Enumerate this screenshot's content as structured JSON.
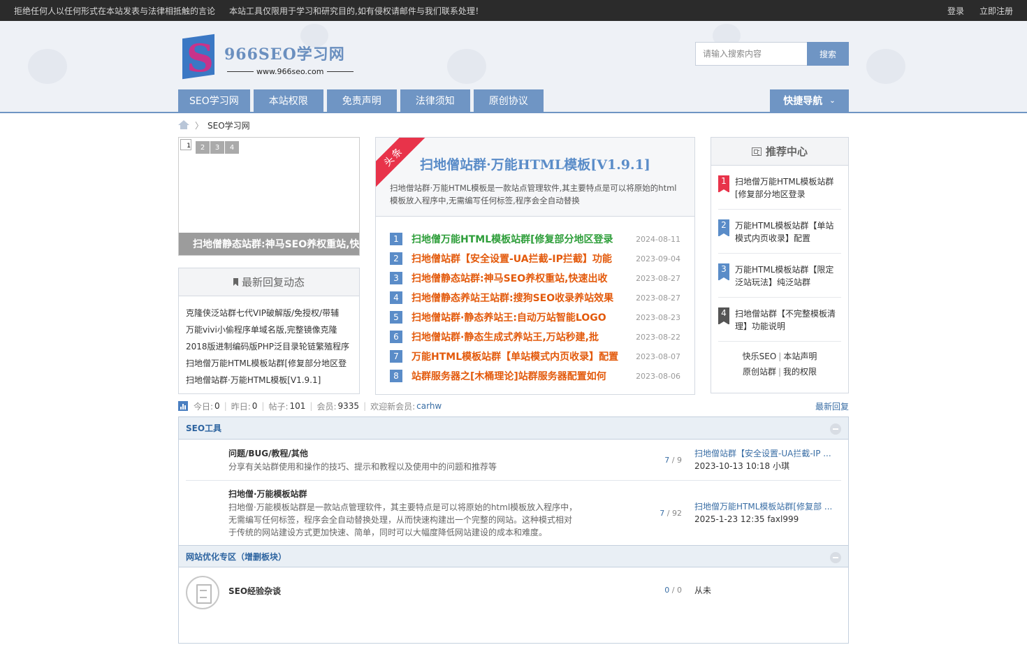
{
  "topbar": {
    "notice1": "拒绝任何人以任何形式在本站发表与法律相抵触的言论",
    "notice2": "本站工具仅限用于学习和研究目的,如有侵权请邮件与我们联系处理！",
    "login": "登录",
    "register": "立即注册"
  },
  "logo": {
    "mark": "S",
    "title": "966SEO学习网",
    "url": "www.966seo.com"
  },
  "search": {
    "placeholder": "请输入搜索内容",
    "button": "搜索"
  },
  "nav": [
    "SEO学习网",
    "本站权限",
    "免责声明",
    "法律须知",
    "原创协议"
  ],
  "quicknav": {
    "label": "快捷导航",
    "icon": "chevron-down-icon"
  },
  "breadcrumb": {
    "current": "SEO学习网"
  },
  "slider": {
    "broken_label": "1",
    "dots": [
      "2",
      "3",
      "4"
    ],
    "caption": "扫地僧静态站群:神马SEO养权重站,快速出收"
  },
  "reply_box": {
    "title": "最新回复动态",
    "items": [
      "克隆侠泛站群七代VIP破解版/免授权/带辅",
      "万能vivi小偷程序单域名版,完整镜像克隆",
      "2018版进制编码版PHP泛目录轮链繁殖程序",
      "扫地僧万能HTML模板站群[修复部分地区登",
      "扫地僧站群·万能HTML模板[V1.9.1]"
    ]
  },
  "headline": {
    "ribbon": "头条",
    "title": "扫地僧站群·万能HTML模板[V1.9.1]",
    "desc": "扫地僧站群·万能HTML模板是一款站点管理软件,其主要特点是可以将原始的html模板放入程序中,无需编写任何标签,程序会全自动替换"
  },
  "news": [
    {
      "num": "1",
      "title": "扫地僧万能HTML模板站群[修复部分地区登录",
      "date": "2024-08-11"
    },
    {
      "num": "2",
      "title": "扫地僧站群【安全设置-UA拦截-IP拦截】功能",
      "date": "2023-09-04"
    },
    {
      "num": "3",
      "title": "扫地僧静态站群:神马SEO养权重站,快速出收",
      "date": "2023-08-27"
    },
    {
      "num": "4",
      "title": "扫地僧静态养站王站群:搜狗SEO收录养站效果",
      "date": "2023-08-27"
    },
    {
      "num": "5",
      "title": "扫地僧站群·静态养站王:自动万站智能LOGO",
      "date": "2023-08-23"
    },
    {
      "num": "6",
      "title": "扫地僧站群·静态生成式养站王,万站秒建,批",
      "date": "2023-08-22"
    },
    {
      "num": "7",
      "title": "万能HTML模板站群【单站模式内页收录】配置",
      "date": "2023-08-07"
    },
    {
      "num": "8",
      "title": "站群服务器之[木桶理论]站群服务器配置如何",
      "date": "2023-08-06"
    }
  ],
  "recommend": {
    "title": "推荐中心",
    "items": [
      {
        "num": "1",
        "text": "扫地僧万能HTML模板站群[修复部分地区登录"
      },
      {
        "num": "2",
        "text": "万能HTML模板站群【单站模式内页收录】配置"
      },
      {
        "num": "3",
        "text": "万能HTML模板站群【限定泛站玩法】纯泛站群"
      },
      {
        "num": "4",
        "text": "扫地僧站群【不完整模板清理】功能说明"
      }
    ],
    "links_row1": [
      "快乐SEO",
      "本站声明"
    ],
    "links_row2": [
      "原创站群",
      "我的权限"
    ]
  },
  "stats": {
    "today_label": "今日:",
    "today": "0",
    "yesterday_label": "昨日:",
    "yesterday": "0",
    "posts_label": "帖子:",
    "posts": "101",
    "members_label": "会员:",
    "members": "9335",
    "welcome_label": "欢迎新会员:",
    "new_member": "carhw",
    "latest_replies": "最新回复"
  },
  "forum": {
    "cat1": {
      "title": "SEO工具",
      "boards": [
        {
          "name": "问题/BUG/教程/其他",
          "desc": "分享有关站群使用和操作的技巧、提示和教程以及使用中的问题和推荐等",
          "threads": "7",
          "posts": "9",
          "last_title": "扫地僧站群【安全设置-UA拦截-IP ...",
          "last_meta": "2023-10-13 10:18 小琪"
        },
        {
          "name": "扫地僧·万能模板站群",
          "desc1": "扫地僧·万能模板站群是一款站点管理软件，其主要特点是可以将原始的html模板放入程序中，",
          "desc2": "无需编写任何标签，程序会全自动替换处理，从而快速构建出一个完整的网站。这种模式相对",
          "desc3": "于传统的网站建设方式更加快速、简单，同时可以大幅度降低网站建设的成本和难度。",
          "threads": "7",
          "posts": "92",
          "last_title": "扫地僧万能HTML模板站群[修复部 ...",
          "last_meta": "2025-1-23 12:35 faxl999"
        }
      ]
    },
    "cat2": {
      "title": "网站优化专区（增删板块）",
      "boards": [
        {
          "name": "SEO经验杂谈",
          "threads": "0",
          "posts": "0",
          "last": "从未"
        }
      ]
    },
    "count_sep": " / "
  }
}
